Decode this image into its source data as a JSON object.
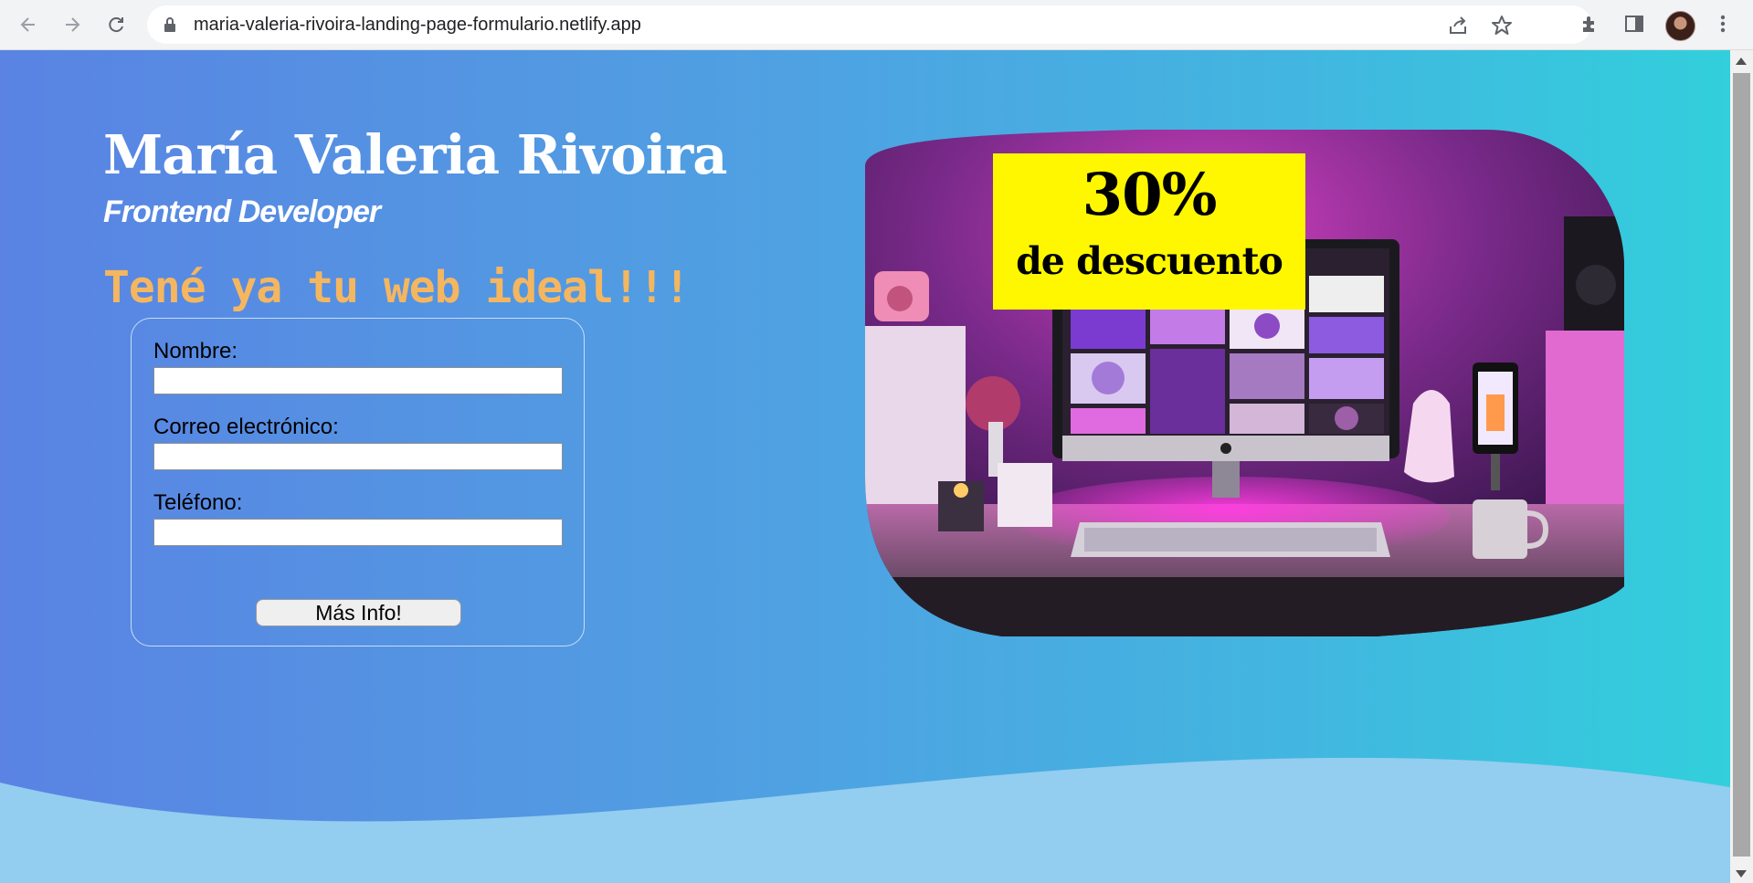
{
  "browser": {
    "url": "maria-valeria-rivoira-landing-page-formulario.netlify.app",
    "icons": [
      "back-icon",
      "forward-icon",
      "reload-icon",
      "lock-icon",
      "share-icon",
      "star-icon",
      "extensions-icon",
      "side-panel-icon",
      "avatar",
      "menu-icon"
    ]
  },
  "header": {
    "name": "María Valeria Rivoira",
    "role": "Frontend Developer"
  },
  "tagline": "Tené ya tu web ideal!!!",
  "form": {
    "name_label": "Nombre:",
    "name_value": "",
    "email_label": "Correo electrónico:",
    "email_value": "",
    "phone_label": "Teléfono:",
    "phone_value": "",
    "submit_label": "Más Info!"
  },
  "promo": {
    "percent": "30%",
    "text": "de descuento"
  },
  "colors": {
    "title": "#ffffff",
    "tagline": "#f5b660",
    "promo_bg": "#fff700",
    "wave": "#93cdf0"
  }
}
